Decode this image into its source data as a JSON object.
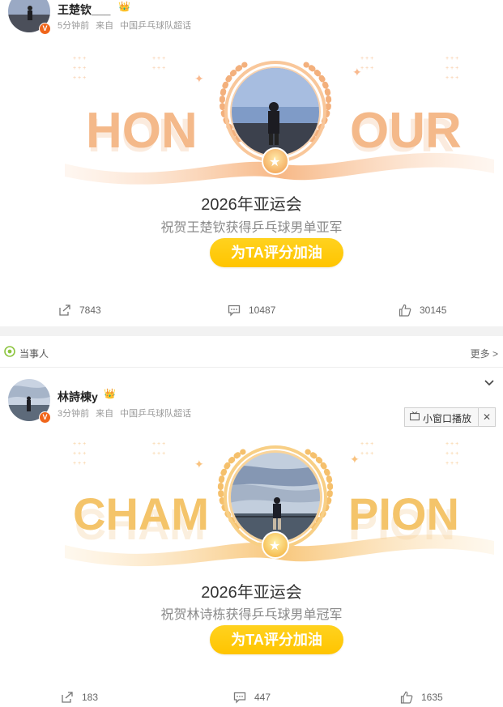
{
  "posts": [
    {
      "username": "王楚钦___",
      "time": "5分钟前",
      "source_prefix": "来自",
      "source": "中国乒乓球队超话",
      "banner": {
        "word_left": "HON",
        "word_right": "OUR"
      },
      "event_title": "2026年亚运会",
      "event_subtitle": "祝贺王楚钦获得乒乓球男单亚军",
      "cheer_label": "为TA评分加油",
      "reposts": "7843",
      "comments": "10487",
      "likes": "30145"
    },
    {
      "username": "林詩棟y",
      "time": "3分钟前",
      "source_prefix": "来自",
      "source": "中国乒乓球队超话",
      "banner": {
        "word_left": "CHAM",
        "word_right": "PION"
      },
      "event_title": "2026年亚运会",
      "event_subtitle": "祝贺林诗栋获得乒乓球男单冠军",
      "cheer_label": "为TA评分加油",
      "reposts": "183",
      "comments": "447",
      "likes": "1635"
    }
  ],
  "topic_bar": {
    "label": "当事人",
    "more": "更多 >"
  },
  "mini_player": {
    "label": "小窗口播放",
    "close": "✕"
  },
  "icons": {
    "verified_badge": "V",
    "crown": "👑"
  },
  "colors": {
    "honour_text": "#f4b98a",
    "champion_text": "#f4c46a",
    "button_yellow": "#ffc400",
    "verified_orange": "#f0651a"
  }
}
